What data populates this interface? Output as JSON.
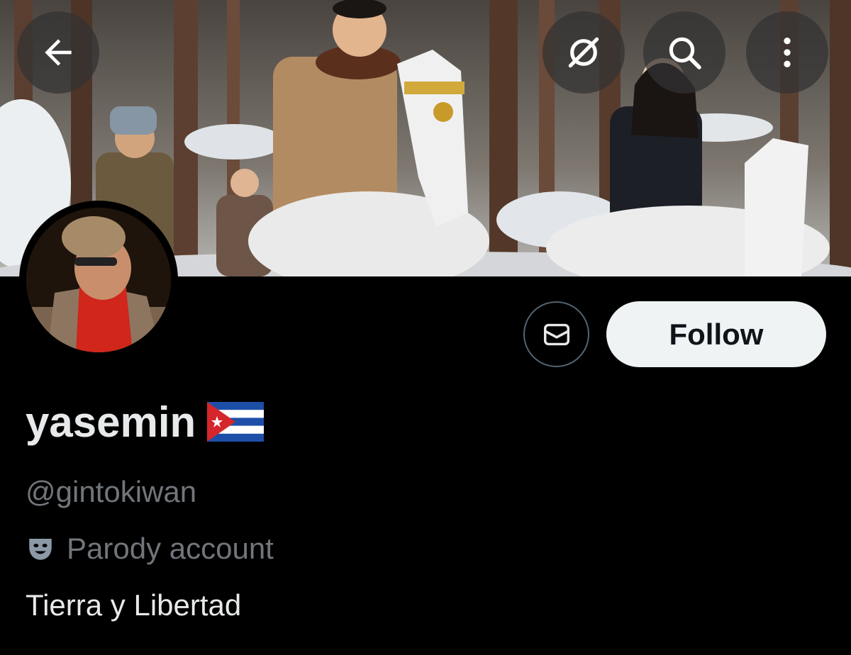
{
  "header": {
    "back_icon": "arrow-left-icon",
    "grok_icon": "grok-icon",
    "search_icon": "search-icon",
    "more_icon": "more-vertical-icon"
  },
  "profile": {
    "display_name": "yasemin",
    "flag_icon": "cuba-flag-icon",
    "handle": "@gintokiwan",
    "parody_label": "Parody account",
    "parody_icon": "theater-mask-icon",
    "bio": "Tierra y Libertad"
  },
  "actions": {
    "message_icon": "envelope-icon",
    "follow_label": "Follow"
  },
  "colors": {
    "background": "#000000",
    "primary_text": "#e7e9ea",
    "secondary_text": "#71767b",
    "follow_bg": "#eff3f4",
    "button_border": "#536471"
  }
}
